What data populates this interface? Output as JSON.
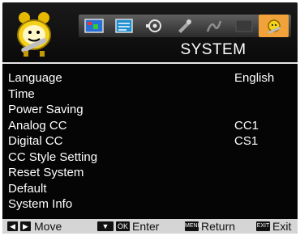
{
  "header": {
    "title": "SYSTEM",
    "tabs": [
      {
        "icon": "picture-icon"
      },
      {
        "icon": "sound-icon"
      },
      {
        "icon": "channel-icon"
      },
      {
        "icon": "lock-icon"
      },
      {
        "icon": "setup-icon"
      },
      {
        "icon": "media-icon"
      },
      {
        "icon": "system-icon",
        "active": true
      }
    ],
    "mascot_icon": "clock-wrench-icon"
  },
  "menu": {
    "items": [
      {
        "label": "Language",
        "value": "English"
      },
      {
        "label": "Time",
        "value": ""
      },
      {
        "label": "Power Saving",
        "value": ""
      },
      {
        "label": "Analog CC",
        "value": "CC1"
      },
      {
        "label": "Digital CC",
        "value": "CS1"
      },
      {
        "label": "CC Style Setting",
        "value": ""
      },
      {
        "label": "Reset System",
        "value": ""
      },
      {
        "label": "Default",
        "value": ""
      },
      {
        "label": "System Info",
        "value": ""
      }
    ]
  },
  "footer": {
    "move_label": "Move",
    "ok_key": "OK",
    "enter_label": "Enter",
    "menu_key": "MENU",
    "return_label": "Return",
    "exit_key": "EXIT",
    "exit_label": "Exit"
  },
  "colors": {
    "background": "#050505",
    "active_tab": "#f2a23a",
    "footer": "#d5d5d5",
    "text": "#ffffff"
  }
}
